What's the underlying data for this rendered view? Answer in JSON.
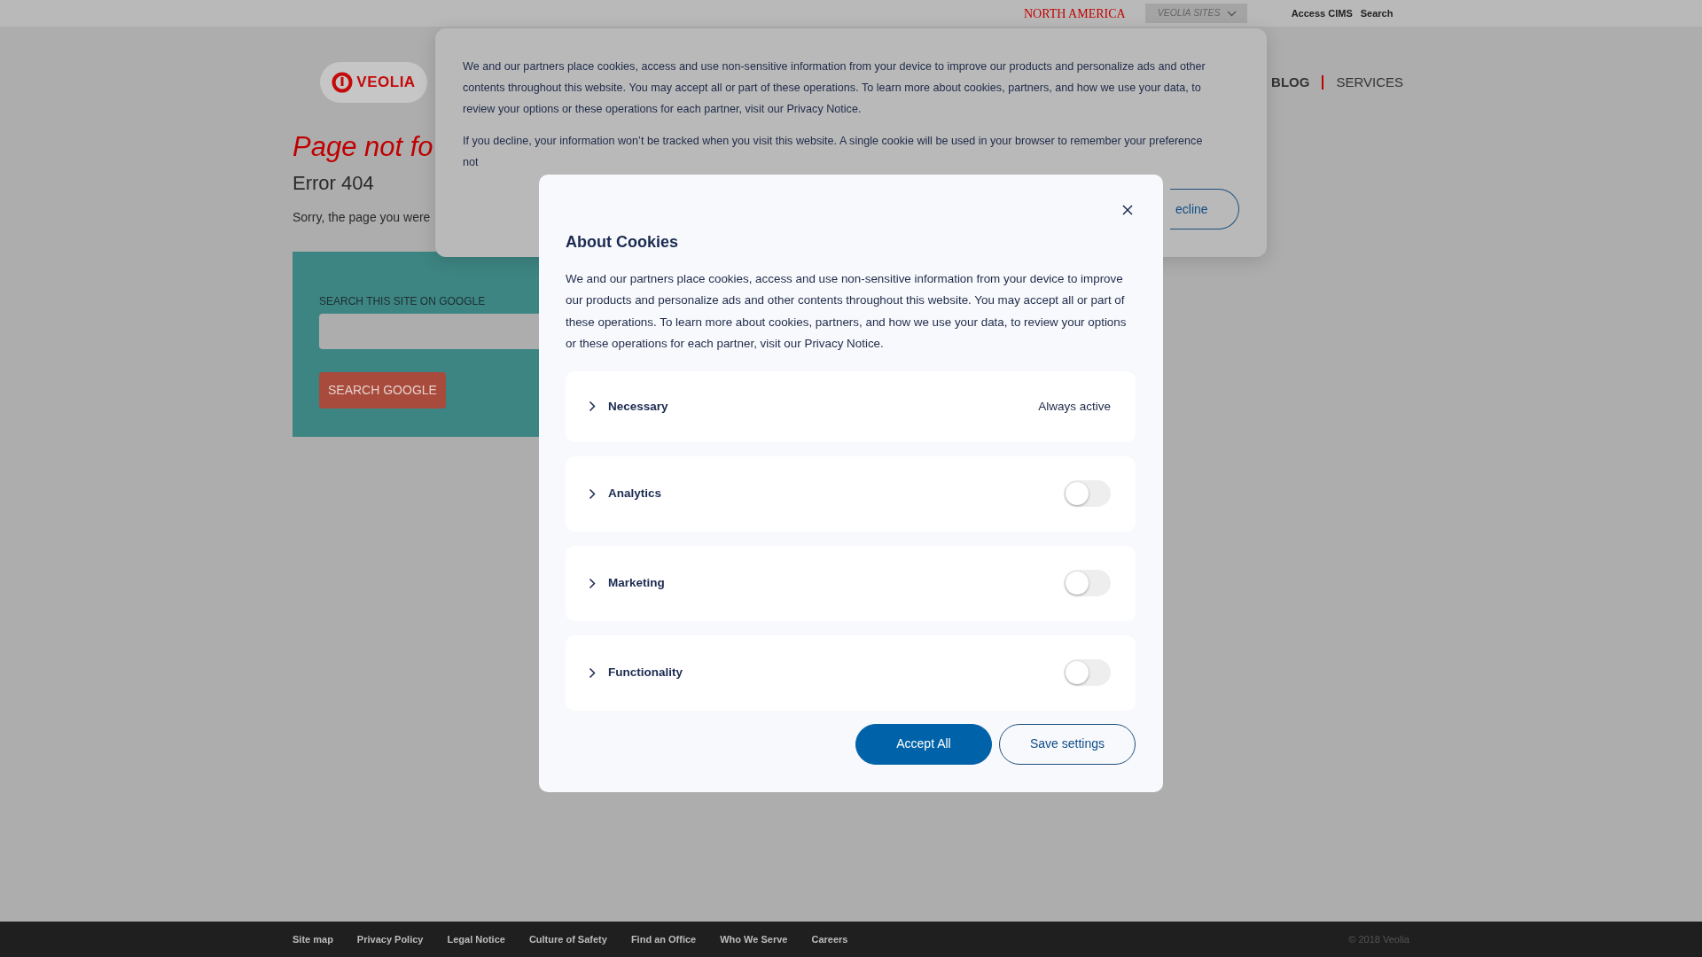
{
  "top_bar": {
    "region": "NORTH AMERICA",
    "sites_menu": "VEOLIA SITES",
    "links": [
      "Access CIMS",
      "Search"
    ]
  },
  "header": {
    "logo": "VEOLIA",
    "nav": [
      {
        "label": "BLOG",
        "selected": true
      },
      {
        "label": "SERVICES",
        "selected": false
      }
    ]
  },
  "page": {
    "title": "Page not fo",
    "subtitle": "Error 404",
    "message": "Sorry, the page you were",
    "search": {
      "label": "SEARCH THIS SITE ON GOOGLE",
      "button": "SEARCH GOOGLE"
    }
  },
  "cookie_banner": {
    "paragraphs": [
      "We and our partners place cookies, access and use non-sensitive information from your device to improve our products and personalize ads and other contents throughout this website. You may accept all or part of these operations. To learn more about cookies, partners, and how we use your data, to review your options or these operations for each partner, visit our Privacy Notice.",
      "If you decline, your information won’t be tracked when you visit this website. A single cookie will be used in your browser to remember your preference not"
    ],
    "decline_button": "ecline"
  },
  "cookie_modal": {
    "title": "About Cookies",
    "description": "We and our partners place cookies, access and use non-sensitive information from your device to improve our products and personalize ads and other contents throughout this website. You may accept all or part of these operations. To learn more about cookies, partners, and how we use your data, to review your options or these operations for each partner, visit our Privacy Notice.",
    "categories": [
      {
        "label": "Necessary",
        "kind": "status",
        "status": "Always active"
      },
      {
        "label": "Analytics",
        "kind": "toggle",
        "on": false
      },
      {
        "label": "Marketing",
        "kind": "toggle",
        "on": false
      },
      {
        "label": "Functionality",
        "kind": "toggle",
        "on": false
      }
    ],
    "buttons": [
      {
        "label": "Accept All",
        "kind": "primary"
      },
      {
        "label": "Save settings",
        "kind": "outline"
      }
    ]
  },
  "footer": {
    "links": [
      "Site map",
      "Privacy Policy",
      "Legal Notice",
      "Culture of Safety",
      "Find an Office",
      "Who We Serve",
      "Careers"
    ],
    "copyright": "© 2018 Veolia"
  }
}
